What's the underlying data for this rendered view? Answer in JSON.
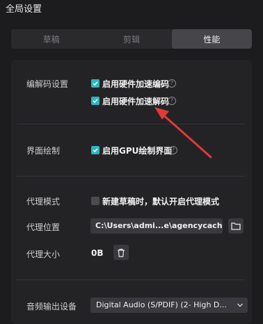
{
  "window": {
    "title": "全局设置"
  },
  "tabs": [
    {
      "label": "草稿",
      "active": false
    },
    {
      "label": "剪辑",
      "active": false
    },
    {
      "label": "性能",
      "active": true
    }
  ],
  "codec": {
    "label": "编解码设置",
    "options": [
      {
        "label": "启用硬件加速编码",
        "checked": true
      },
      {
        "label": "启用硬件加速解码",
        "checked": true
      }
    ]
  },
  "ui_render": {
    "label": "界面绘制",
    "option": {
      "label": "启用GPU绘制界面",
      "checked": true
    }
  },
  "proxy": {
    "mode_label": "代理模式",
    "mode_option": {
      "label": "新建草稿时，默认开启代理模式",
      "checked": false
    },
    "location_label": "代理位置",
    "location_value": "C:\\Users\\admi...e\\agencycache",
    "size_label": "代理大小",
    "size_value": "0B"
  },
  "audio": {
    "label": "音频输出设备",
    "value": "Digital Audio (S/PDIF) (2- High D..."
  },
  "colors": {
    "accent": "#2bb6c1",
    "annotation": "#e03a3a"
  },
  "icons": [
    "help-icon",
    "folder-icon",
    "trash-icon",
    "chevron-down-icon",
    "check-icon"
  ]
}
